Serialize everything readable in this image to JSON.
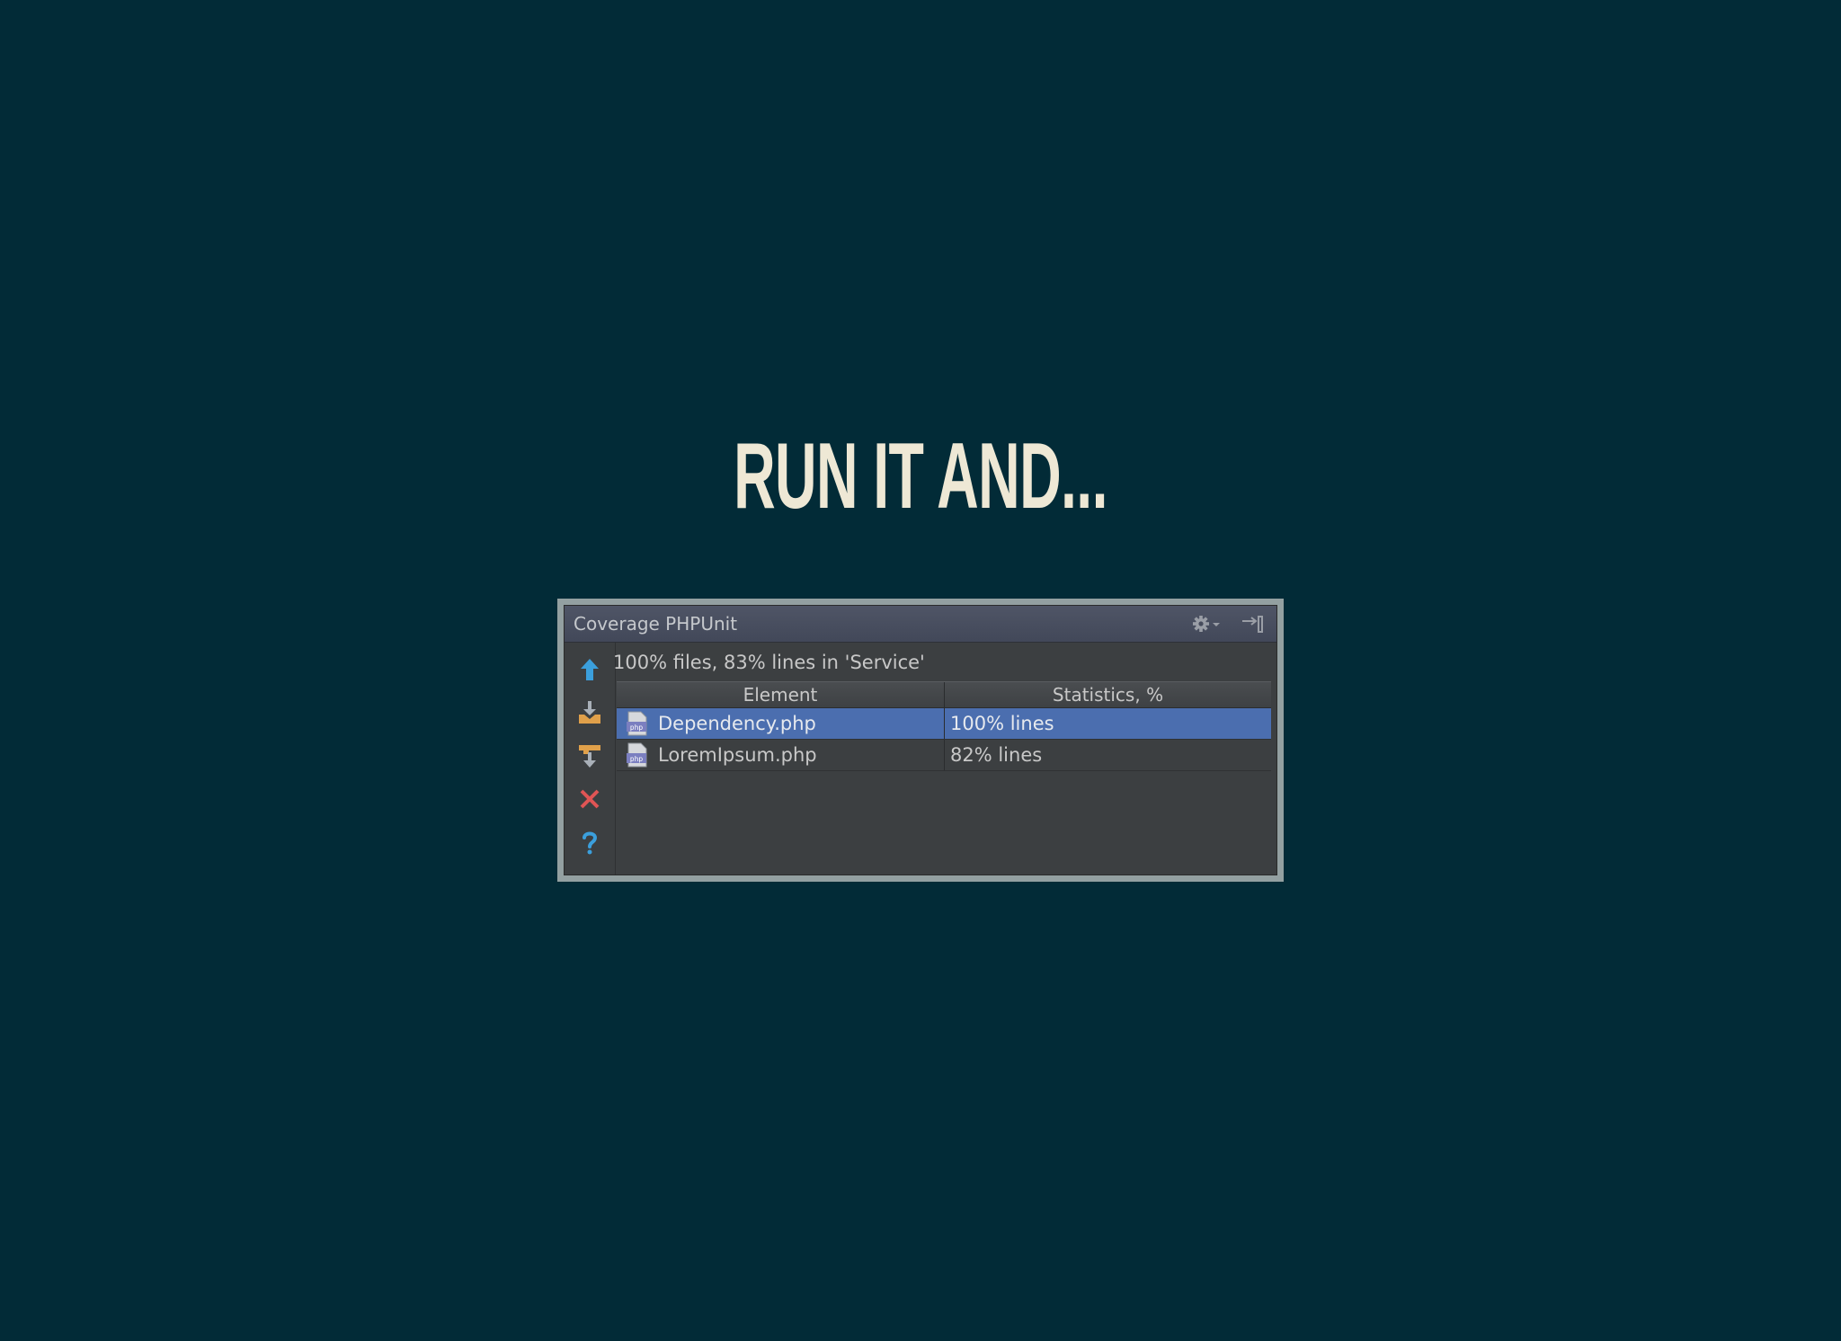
{
  "slide": {
    "title": "RUN IT AND..."
  },
  "panel": {
    "title": "Coverage PHPUnit",
    "summary": "100% files, 83% lines in 'Service'",
    "toolbar": [
      "go-up-icon",
      "import-icon",
      "generate-report-icon",
      "close-icon",
      "help-icon"
    ],
    "header_icons": [
      "gear-icon",
      "hide-panel-icon"
    ]
  },
  "table": {
    "columns": [
      "Element",
      "Statistics, %"
    ],
    "rows": [
      {
        "name": "Dependency.php",
        "stats": "100% lines",
        "selected": true
      },
      {
        "name": "LoremIpsum.php",
        "stats": "82% lines",
        "selected": false
      }
    ]
  },
  "colors": {
    "background": "#022b37",
    "title": "#eee8d5",
    "selection": "#4b6eaf",
    "panel_bg": "#3c3f41"
  }
}
